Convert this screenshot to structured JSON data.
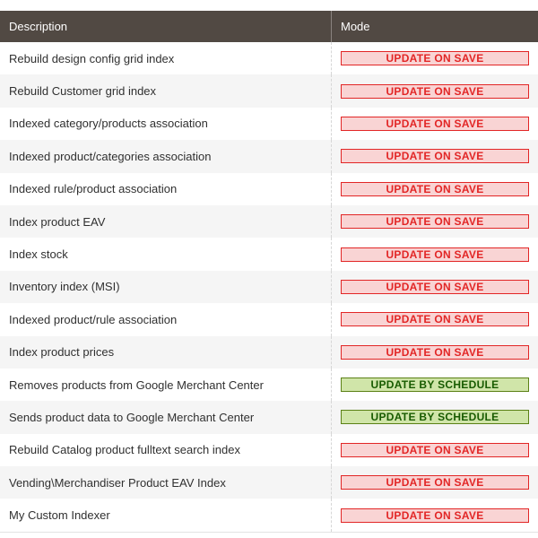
{
  "header": {
    "description": "Description",
    "mode": "Mode"
  },
  "colors": {
    "header_bg": "#514943",
    "save_badge": "#e22626",
    "schedule_badge": "#5b8116"
  },
  "rows": [
    {
      "description": "Rebuild design config grid index",
      "mode": "UPDATE ON SAVE",
      "status": "red"
    },
    {
      "description": "Rebuild Customer grid index",
      "mode": "UPDATE ON SAVE",
      "status": "red"
    },
    {
      "description": "Indexed category/products association",
      "mode": "UPDATE ON SAVE",
      "status": "red"
    },
    {
      "description": "Indexed product/categories association",
      "mode": "UPDATE ON SAVE",
      "status": "red"
    },
    {
      "description": "Indexed rule/product association",
      "mode": "UPDATE ON SAVE",
      "status": "red"
    },
    {
      "description": "Index product EAV",
      "mode": "UPDATE ON SAVE",
      "status": "red"
    },
    {
      "description": "Index stock",
      "mode": "UPDATE ON SAVE",
      "status": "red"
    },
    {
      "description": "Inventory index (MSI)",
      "mode": "UPDATE ON SAVE",
      "status": "red"
    },
    {
      "description": "Indexed product/rule association",
      "mode": "UPDATE ON SAVE",
      "status": "red"
    },
    {
      "description": "Index product prices",
      "mode": "UPDATE ON SAVE",
      "status": "red"
    },
    {
      "description": "Removes products from Google Merchant Center",
      "mode": "UPDATE BY SCHEDULE",
      "status": "green"
    },
    {
      "description": "Sends product data to Google Merchant Center",
      "mode": "UPDATE BY SCHEDULE",
      "status": "green"
    },
    {
      "description": "Rebuild Catalog product fulltext search index",
      "mode": "UPDATE ON SAVE",
      "status": "red"
    },
    {
      "description": "Vending\\Merchandiser Product EAV Index",
      "mode": "UPDATE ON SAVE",
      "status": "red"
    },
    {
      "description": "My Custom Indexer",
      "mode": "UPDATE ON SAVE",
      "status": "red"
    }
  ]
}
